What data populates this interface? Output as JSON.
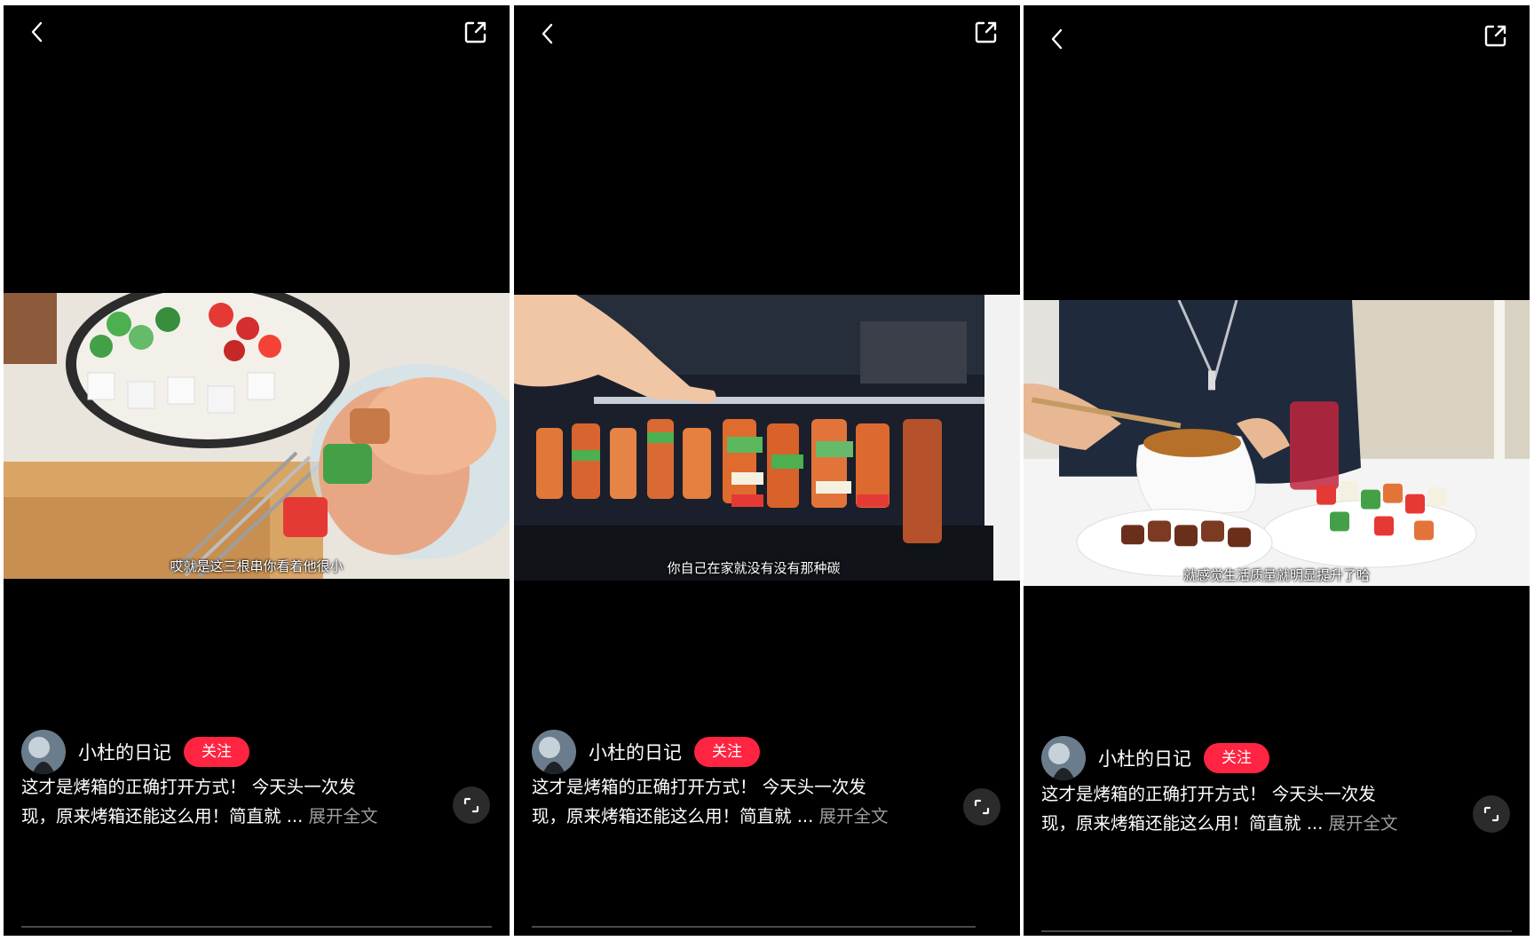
{
  "author": {
    "name": "小杜的日记",
    "follow_label": "关注"
  },
  "caption": {
    "line1": "这才是烤箱的正确打开方式！ 今天头一次发",
    "line2": "现，原来烤箱还能这么用！简直就 ...",
    "expand_label": "展开全文"
  },
  "panels": [
    {
      "subtitle": "哎就是这三根串你看着他很小"
    },
    {
      "subtitle": "你自己在家就没有没有那种碳"
    },
    {
      "subtitle": "就感觉生活质量就明显提升了哈"
    }
  ],
  "icons": {
    "back": "chevron-left-icon",
    "share": "share-out-icon",
    "fullscreen": "fullscreen-icon"
  },
  "colors": {
    "follow": "#ff2442",
    "background": "#000000",
    "expand_text": "#9e9e9e"
  }
}
